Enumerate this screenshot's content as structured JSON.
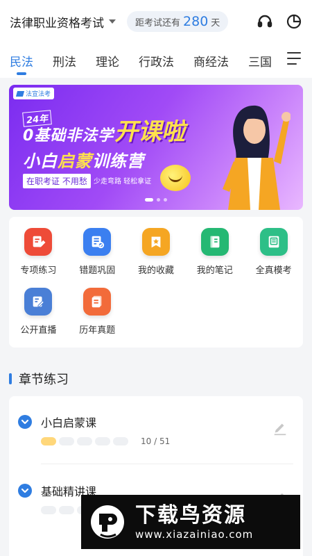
{
  "header": {
    "exam_name": "法律职业资格考试",
    "countdown_prefix": "距考试还有",
    "countdown_days": "280",
    "countdown_suffix": "天",
    "icons": [
      "headset-icon",
      "pie-chart-icon"
    ]
  },
  "tabs": [
    {
      "label": "民法",
      "active": true
    },
    {
      "label": "刑法",
      "active": false
    },
    {
      "label": "理论",
      "active": false
    },
    {
      "label": "行政法",
      "active": false
    },
    {
      "label": "商经法",
      "active": false
    },
    {
      "label": "三国",
      "active": false
    }
  ],
  "banner": {
    "brand": "法宣法考",
    "year": "24年",
    "headline_1": "0基础非法学",
    "headline_1b": "开课啦",
    "headline_2_a": "小白",
    "headline_2_b": "启蒙",
    "headline_2_c": "训练营",
    "tag_1": "在职考证 不用愁",
    "tag_2": "少走弯路 轻松拿证",
    "slide_count": 3,
    "active_slide": 1
  },
  "features": [
    {
      "label": "专项练习",
      "icon": "pencil-doc-icon",
      "color": "#ee4b38"
    },
    {
      "label": "错题巩固",
      "icon": "checklist-icon",
      "color": "#3b7ff0"
    },
    {
      "label": "我的收藏",
      "icon": "star-folder-icon",
      "color": "#f5a623"
    },
    {
      "label": "我的笔记",
      "icon": "notebook-icon",
      "color": "#25b873"
    },
    {
      "label": "全真模考",
      "icon": "exam-paper-icon",
      "color": "#2dbf87"
    },
    {
      "label": "公开直播",
      "icon": "live-edit-icon",
      "color": "#4a7fd6"
    },
    {
      "label": "历年真题",
      "icon": "papers-icon",
      "color": "#f26b3a"
    }
  ],
  "section": {
    "title": "章节练习"
  },
  "chapters": [
    {
      "name": "小白启蒙课",
      "done": 10,
      "total": 51,
      "count_text": "10 / 51"
    },
    {
      "name": "基础精讲课",
      "done": 0,
      "total": 0,
      "count_text": ""
    }
  ],
  "watermark": {
    "title": "下载鸟资源",
    "url": "www.xiazainiao.com"
  },
  "colors": {
    "accent": "#2f7de1",
    "progress_done": "#ffd77a"
  }
}
